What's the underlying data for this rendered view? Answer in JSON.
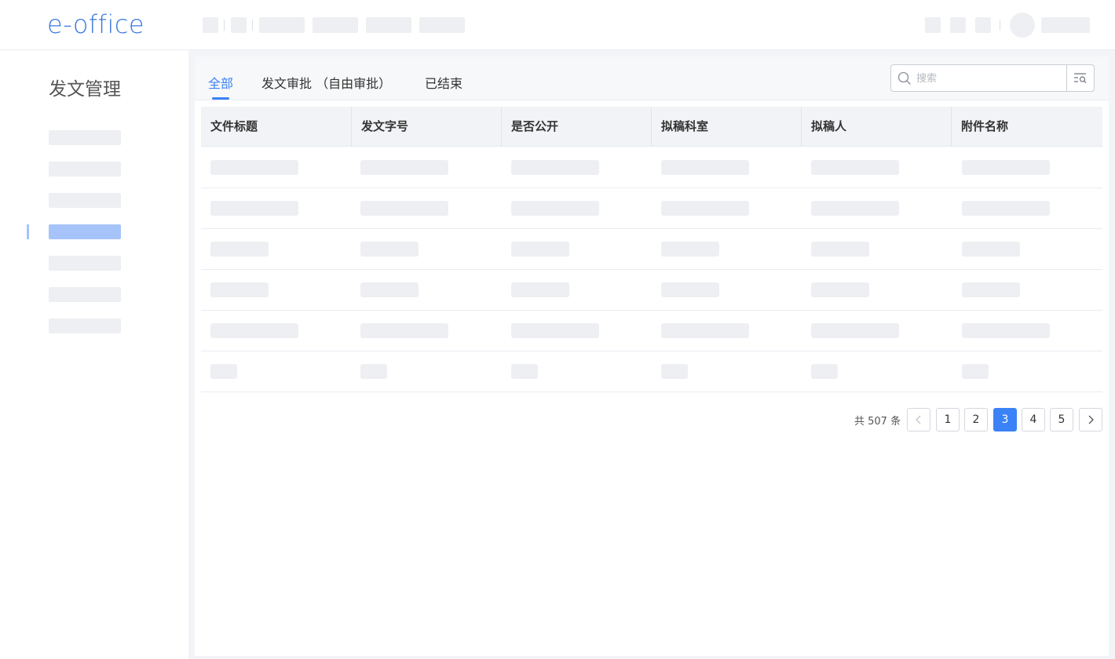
{
  "app": {
    "logo_text": "e-office"
  },
  "sidebar": {
    "title": "发文管理",
    "active_index": 3
  },
  "tabs": [
    {
      "label": "全部",
      "active": true
    },
    {
      "label": "发文审批 （自由审批）",
      "active": false
    },
    {
      "label": "已结束",
      "active": false
    }
  ],
  "search": {
    "placeholder": "搜索",
    "value": ""
  },
  "table": {
    "columns": [
      "文件标题",
      "发文字号",
      "是否公开",
      "拟稿科室",
      "拟稿人",
      "附件名称"
    ]
  },
  "pagination": {
    "total_text": "共 507 条",
    "pages": [
      "1",
      "2",
      "3",
      "4",
      "5"
    ],
    "current": "3"
  },
  "colors": {
    "accent": "#3b82f6",
    "logo": "#3a78e0",
    "placeholder": "#eeeff2",
    "active_nav": "#a6c4fa"
  }
}
